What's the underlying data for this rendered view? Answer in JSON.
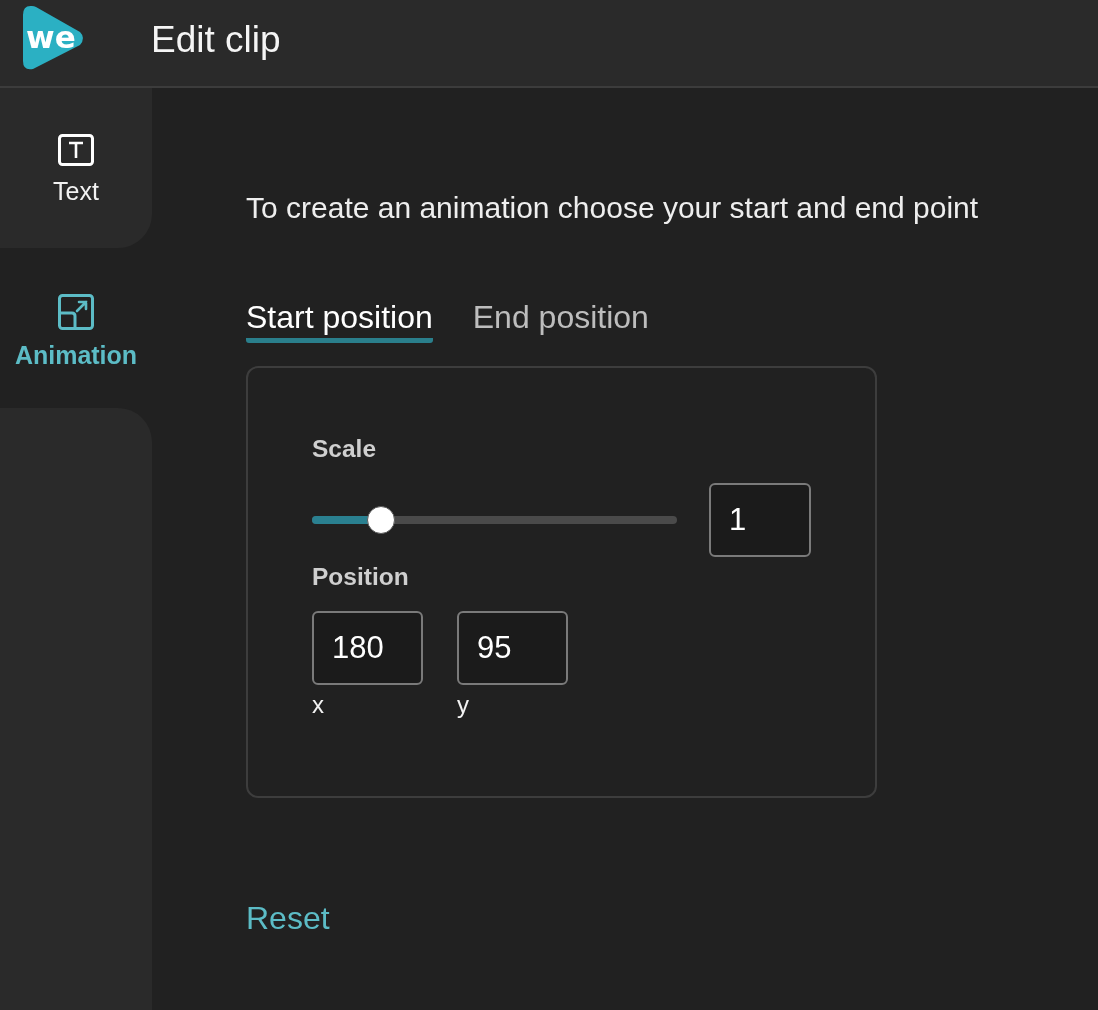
{
  "header": {
    "logo_text": "we",
    "title": "Edit clip"
  },
  "sidebar": {
    "items": [
      {
        "kind": "text",
        "label": "Text",
        "selected": false
      },
      {
        "kind": "animation",
        "label": "Animation",
        "selected": true
      }
    ]
  },
  "instruction": "To create an animation choose your start and end point",
  "tabs": [
    {
      "label": "Start position",
      "selected": true
    },
    {
      "label": "End position",
      "selected": false
    }
  ],
  "panel": {
    "scale": {
      "label": "Scale",
      "level": 0.19,
      "value": "1"
    },
    "position": {
      "label": "Position",
      "fields": [
        {
          "value": "180",
          "caption": "x"
        },
        {
          "value": "95",
          "caption": "y"
        }
      ]
    }
  },
  "reset": "Reset"
}
